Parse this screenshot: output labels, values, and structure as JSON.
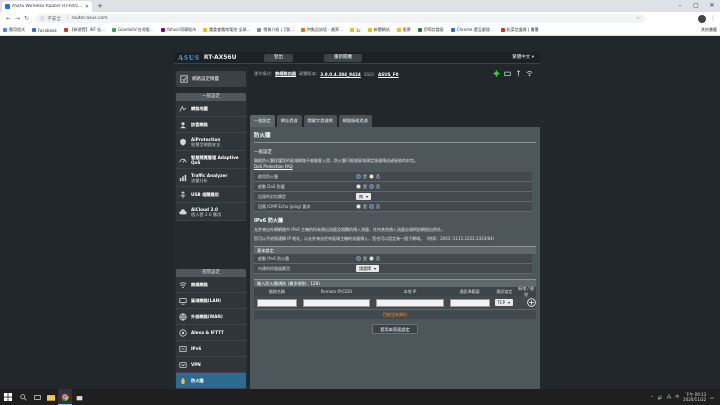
{
  "browser": {
    "tab_title": "ASUS Wireless Router RT-AX5…",
    "address_prefix": "不安全",
    "address": "router.asus.com",
    "bookmarks": [
      {
        "label": "應用程式",
        "color": "#4285f4"
      },
      {
        "label": "Facebook",
        "color": "#1877f2"
      },
      {
        "label": "【新遊覽】iKF 佳…",
        "color": "#d93025"
      },
      {
        "label": "Goodinfo!台灣股…",
        "color": "#34a853"
      },
      {
        "label": "Yahoo!奇摩股市",
        "color": "#7b0099"
      },
      {
        "label": "農委會農地電池·全球…",
        "color": "#fbbc04"
      },
      {
        "label": "帶貨介紹 |【我…",
        "color": "#888888"
      },
      {
        "label": "特點告訴您 - 美界…",
        "color": "#e37400"
      },
      {
        "label": "3c",
        "color": "#fbbc04"
      },
      {
        "label": "新聞網站",
        "color": "#fbbc04"
      },
      {
        "label": "股票",
        "color": "#fbbc04"
      },
      {
        "label": "伊莉討論區",
        "color": "#188038"
      },
      {
        "label": "Chrome 還沒處理…",
        "color": "#1a73e8"
      },
      {
        "label": "松菜信盒資 | 書署",
        "color": "#d93025"
      }
    ],
    "other_bookmarks": "其他書籤"
  },
  "header": {
    "logo": "ASUS",
    "model": "RT-AX56U",
    "logout": "登出",
    "reboot": "重新開機",
    "language": "繁體中文"
  },
  "status": {
    "mode_label": "運作模式:",
    "mode_value": "無線路由器",
    "fw_label": "韌體版本:",
    "fw_value": "3.0.0.4.384_9424",
    "ssid_label": "SSID:",
    "ssid_value": "ASUS_F0"
  },
  "sidebar": {
    "qis": "網路設定精靈",
    "general_head": "一般設定",
    "advanced_head": "進階設定",
    "general": [
      {
        "title": "網路地圖",
        "sub": ""
      },
      {
        "title": "訪客網路",
        "sub": ""
      },
      {
        "title": "AiProtection",
        "sub": "智慧型網路安全"
      },
      {
        "title": "智慧頻寬管理 Adaptive QoS",
        "sub": ""
      },
      {
        "title": "Traffic Analyzer",
        "sub": "流量分析"
      },
      {
        "title": "USB 相關應用",
        "sub": ""
      },
      {
        "title": "AiCloud 2.0",
        "sub": "個人雲 2.0 應用"
      }
    ],
    "advanced": [
      {
        "title": "無線網路",
        "sub": ""
      },
      {
        "title": "區域網路(LAN)",
        "sub": ""
      },
      {
        "title": "外部網路(WAN)",
        "sub": ""
      },
      {
        "title": "Alexa & IFTTT",
        "sub": ""
      },
      {
        "title": "IPv6",
        "sub": ""
      },
      {
        "title": "VPN",
        "sub": ""
      },
      {
        "title": "防火牆",
        "sub": ""
      },
      {
        "title": "系統管理",
        "sub": ""
      }
    ]
  },
  "tabs": [
    "一般設定",
    "網址過濾",
    "關鍵字過濾網",
    "網路服務過濾"
  ],
  "panel": {
    "title": "防火牆",
    "general_title": "一般設定",
    "desc": "開啟防火牆保護您的區域網路不被駭客入侵，防火牆可根據區域規定過濾傳送或接收的封包。",
    "faq": "DoS Protection FAQ",
    "rows": [
      {
        "label": "啟用防火牆",
        "type": "radio",
        "yes": "是",
        "no": "否",
        "value": "yes"
      },
      {
        "label": "啟動 DoS 防護",
        "type": "radio",
        "yes": "是",
        "no": "否",
        "value": "no"
      },
      {
        "label": "記錄的封包類型",
        "type": "select",
        "value": "無"
      },
      {
        "label": "回應 ICMP Echo (ping) 要求",
        "type": "radio",
        "yes": "是",
        "no": "否",
        "value": "no"
      }
    ],
    "ipv6_title": "IPv6 防火牆",
    "ipv6_desc1": "允許來自外網網路中 IPv6 主機的所有傳出流量及相關的傳入流量，任何其他傳入流量必須明對網指出例外。",
    "ipv6_desc2": "您可以不依照通稱 IP 地址，以允許來自任何區域主機的流量傳入，您也可以設定為一個子網域。（例如：2001::1111:2222:3333/64）",
    "basic_head": "基本設定",
    "basic_rows": [
      {
        "label": "啟動 IPv6 防火牆",
        "type": "radio",
        "yes": "是",
        "no": "否",
        "value": "yes"
      },
      {
        "label": "內建的伺服器應用",
        "type": "select",
        "value": "請選擇"
      }
    ],
    "inbound_head": "輸入防火牆規則 (最多規則：128)",
    "cols": [
      "服務名稱",
      "Remote IP/CIDR",
      "本地 IP",
      "通訊埠範圍",
      "通訊協定",
      "新增 / 刪除"
    ],
    "protocol": "TCP",
    "no_data": "目前沒有資料",
    "apply": "套用本頁面設定"
  },
  "taskbar": {
    "time": "下午 09:13",
    "date": "2020/11/22"
  }
}
